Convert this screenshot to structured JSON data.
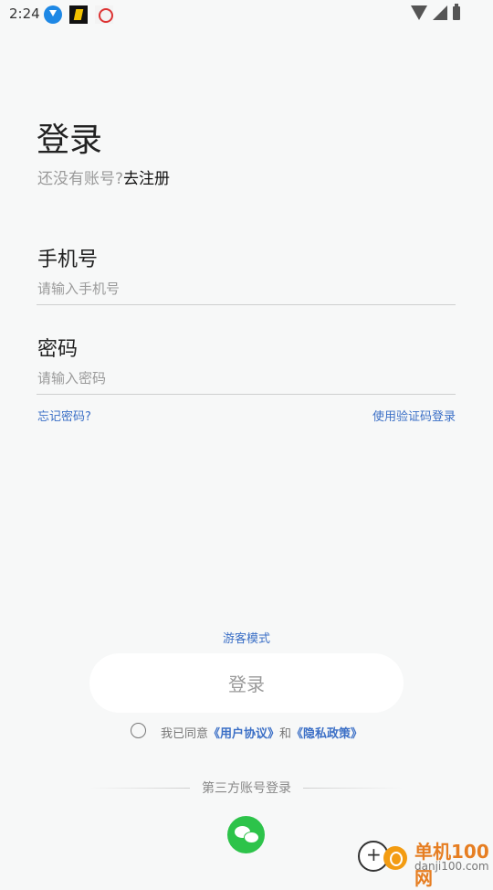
{
  "status_bar": {
    "time": "2:24"
  },
  "header": {
    "title": "登录",
    "register_prompt": "还没有账号?",
    "register_link": "去注册"
  },
  "form": {
    "phone_label": "手机号",
    "phone_placeholder": "请输入手机号",
    "password_label": "密码",
    "password_placeholder": "请输入密码",
    "forgot_password": "忘记密码?",
    "sms_login": "使用验证码登录"
  },
  "footer": {
    "guest_mode": "游客模式",
    "login_button": "登录",
    "agree_prefix": "我已同意",
    "user_agreement": "《用户协议》",
    "and": "和",
    "privacy_policy": "《隐私政策》",
    "third_party_login": "第三方账号登录"
  },
  "watermark": {
    "name": "单机100网",
    "url": "danji100.com"
  },
  "colors": {
    "link": "#3b6fc6",
    "wechat": "#2dc34a",
    "background": "#f7f8f8"
  },
  "icons": [
    "download-icon",
    "app-icon",
    "app-icon",
    "wifi-icon",
    "signal-icon",
    "battery-icon",
    "wechat-icon"
  ]
}
